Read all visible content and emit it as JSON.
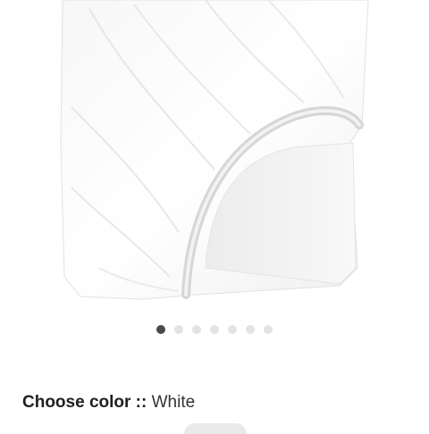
{
  "product_image": {
    "alt": "White fitted sheet",
    "icon": "fitted-sheet-image"
  },
  "carousel": {
    "count": 7,
    "active_index": 0,
    "active_color": "#4a4a4a",
    "inactive_color": "#e3e3e3"
  },
  "color_selector": {
    "label": "Choose color ::",
    "value": "White"
  }
}
